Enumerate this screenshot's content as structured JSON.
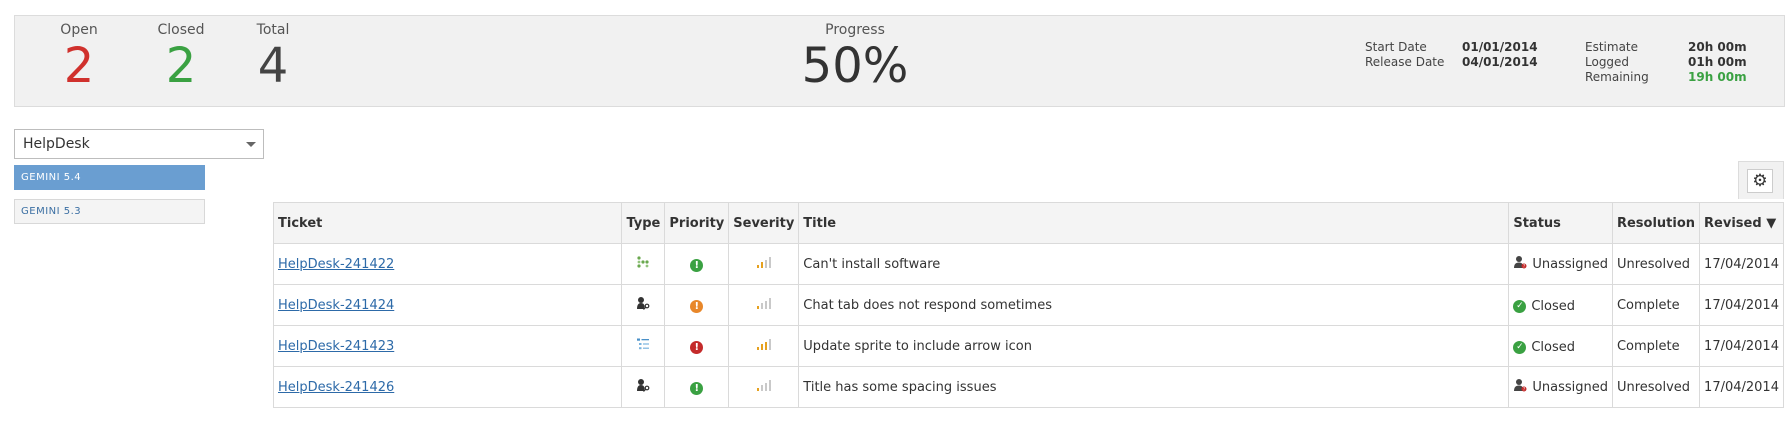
{
  "summary": {
    "open": {
      "label": "Open",
      "value": "2",
      "color": "#d0312d"
    },
    "closed": {
      "label": "Closed",
      "value": "2",
      "color": "#3aa142"
    },
    "total": {
      "label": "Total",
      "value": "4",
      "color": "#444444"
    },
    "progress": {
      "label": "Progress",
      "value": "50%"
    },
    "start_date": {
      "label": "Start Date",
      "value": "01/01/2014"
    },
    "release_date": {
      "label": "Release Date",
      "value": "04/01/2014"
    },
    "estimate": {
      "label": "Estimate",
      "value": "20h 00m"
    },
    "logged": {
      "label": "Logged",
      "value": "01h 00m"
    },
    "remaining": {
      "label": "Remaining",
      "value": "19h 00m",
      "color": "#3aa142"
    }
  },
  "project_select": {
    "value": "HelpDesk"
  },
  "versions": [
    {
      "label": "GEMINI 5.4",
      "active": true
    },
    {
      "label": "GEMINI 5.3",
      "active": false
    }
  ],
  "settings_icon": "gear-icon",
  "table": {
    "columns": [
      "Ticket",
      "Type",
      "Priority",
      "Severity",
      "Title",
      "Status",
      "Resolution",
      "Revised ▼"
    ],
    "rows": [
      {
        "ticket": "HelpDesk-241422",
        "type_icon": "hierarchy-icon",
        "priority": "green",
        "severity_level": 2,
        "title": "Can't install software",
        "status": "Unassigned",
        "status_icon": "unassigned-user-icon",
        "resolution": "Unresolved",
        "revised": "17/04/2014"
      },
      {
        "ticket": "HelpDesk-241424",
        "type_icon": "user-key-icon",
        "priority": "orange",
        "severity_level": 1,
        "title": "Chat tab does not respond sometimes",
        "status": "Closed",
        "status_icon": "check-circle-icon",
        "resolution": "Complete",
        "revised": "17/04/2014"
      },
      {
        "ticket": "HelpDesk-241423",
        "type_icon": "list-icon",
        "priority": "red",
        "severity_level": 3,
        "title": "Update sprite to include arrow icon",
        "status": "Closed",
        "status_icon": "check-circle-icon",
        "resolution": "Complete",
        "revised": "17/04/2014"
      },
      {
        "ticket": "HelpDesk-241426",
        "type_icon": "user-key-icon",
        "priority": "green",
        "severity_level": 1,
        "title": "Title has some spacing issues",
        "status": "Unassigned",
        "status_icon": "unassigned-user-icon",
        "resolution": "Unresolved",
        "revised": "17/04/2014"
      }
    ]
  },
  "colors": {
    "priority_green": "#3aa142",
    "priority_orange": "#e8872a",
    "priority_red": "#c42b2b",
    "severity_active": "#e6a11f",
    "severity_idle": "#c9c9c9",
    "version_active_bg": "#6a9ed1"
  }
}
